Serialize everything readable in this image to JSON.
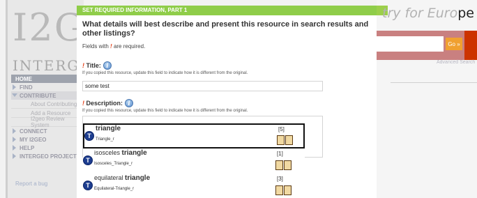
{
  "site": {
    "logo_text": "I2G",
    "logo_sub": "INTERGEO",
    "tagline_faded": "try for Euro",
    "tagline_dark": "pe",
    "search_go": "Go »",
    "advanced_search": "Advanced Search",
    "nav": [
      {
        "label": "HOME"
      },
      {
        "label": "FIND"
      },
      {
        "label": "CONTRIBUTE"
      },
      {
        "label": "About Contributing"
      },
      {
        "label": "Add a Resource"
      },
      {
        "label": "I2geo Review System"
      },
      {
        "label": "CONNECT"
      },
      {
        "label": "MY I2GEO"
      },
      {
        "label": "HELP"
      },
      {
        "label": "INTERGEO PROJECT"
      }
    ],
    "report_bug": "Report a bug"
  },
  "dialog": {
    "header": "SET REQUIRED INFORMATION, PART 1",
    "question": "What details will best describe and present this resource in search results and other listings?",
    "required_prefix": "Fields with",
    "required_mark": "!",
    "required_suffix": "are required.",
    "title_field": {
      "mark": "!",
      "label": "Title:",
      "hint": "If you copied this resource, update this field to indicate how it is different from the original.",
      "value": "some test"
    },
    "description_field": {
      "mark": "!",
      "label": "Description:",
      "hint": "If you copied this resource, update this field to indicate how it is different from the original."
    },
    "info_glyph": "i"
  },
  "suggestions": [
    {
      "prefix": "",
      "keyword": "triangle",
      "sub": "Triangle_r",
      "count": "[5]",
      "icon": "T",
      "highlighted": true
    },
    {
      "prefix": "isosceles ",
      "keyword": "triangle",
      "sub": "Isosceles_Triangle_r",
      "count": "[1]",
      "icon": "T",
      "highlighted": false
    },
    {
      "prefix": "equilateral ",
      "keyword": "triangle",
      "sub": "Equilateral-Triangle_r",
      "count": "[3]",
      "icon": "T",
      "highlighted": false
    }
  ],
  "colors": {
    "header_green": "#8fcd49",
    "required_red": "#e23b12",
    "topic_icon_blue": "#1d3d8f",
    "go_orange": "#f0a030"
  }
}
